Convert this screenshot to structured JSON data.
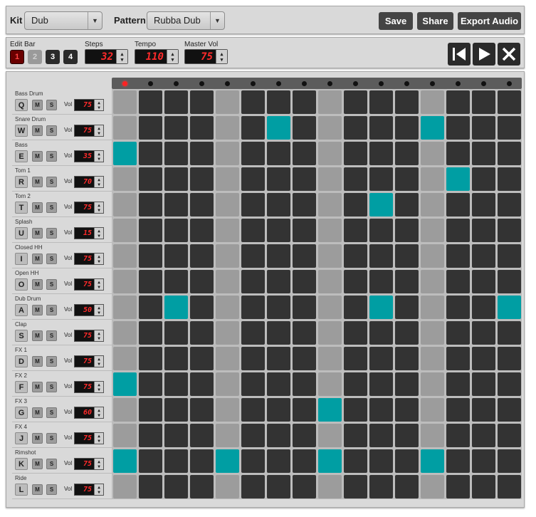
{
  "topbar": {
    "kit_label": "Kit",
    "kit_value": "Dub",
    "pattern_label": "Pattern",
    "pattern_value": "Rubba Dub",
    "save_label": "Save",
    "share_label": "Share",
    "export_label": "Export Audio"
  },
  "controls": {
    "edit_bar_label": "Edit Bar",
    "bars": [
      "1",
      "2",
      "3",
      "4"
    ],
    "active_bar": "1",
    "steps_label": "Steps",
    "steps_value": "32",
    "tempo_label": "Tempo",
    "tempo_value": "110",
    "master_vol_label": "Master Vol",
    "master_vol_value": "75"
  },
  "transport": {
    "rewind_icon": "skip-to-start-icon",
    "play_icon": "play-icon",
    "clear_icon": "close-icon"
  },
  "colors": {
    "active_step": "#009ea3",
    "step": "#333333",
    "beat_step": "#9c9c9c",
    "led_on": "#ff2222",
    "bar_active": "#6a0000"
  },
  "playhead_step": 0,
  "beat_columns": [
    0,
    4,
    8,
    12
  ],
  "track_buttons": {
    "mute": "M",
    "solo": "S",
    "vol_label": "Vol"
  },
  "tracks": [
    {
      "name": "Bass Drum",
      "key": "Q",
      "vol": "75",
      "steps": []
    },
    {
      "name": "Snare Drum",
      "key": "W",
      "vol": "75",
      "steps": [
        6,
        12
      ]
    },
    {
      "name": "Bass",
      "key": "E",
      "vol": "35",
      "steps": [
        0
      ]
    },
    {
      "name": "Tom 1",
      "key": "R",
      "vol": "70",
      "steps": [
        13
      ]
    },
    {
      "name": "Tom 2",
      "key": "T",
      "vol": "75",
      "steps": [
        10
      ]
    },
    {
      "name": "Splash",
      "key": "U",
      "vol": "15",
      "steps": []
    },
    {
      "name": "Closed HH",
      "key": "I",
      "vol": "75",
      "steps": []
    },
    {
      "name": "Open HH",
      "key": "O",
      "vol": "75",
      "steps": []
    },
    {
      "name": "Dub Drum",
      "key": "A",
      "vol": "50",
      "steps": [
        2,
        10,
        15
      ]
    },
    {
      "name": "Clap",
      "key": "S",
      "vol": "75",
      "steps": []
    },
    {
      "name": "FX 1",
      "key": "D",
      "vol": "75",
      "steps": []
    },
    {
      "name": "FX 2",
      "key": "F",
      "vol": "75",
      "steps": [
        0
      ]
    },
    {
      "name": "FX 3",
      "key": "G",
      "vol": "60",
      "steps": [
        8
      ]
    },
    {
      "name": "FX 4",
      "key": "J",
      "vol": "75",
      "steps": []
    },
    {
      "name": "Rimshot",
      "key": "K",
      "vol": "75",
      "steps": [
        0,
        4,
        8,
        12
      ]
    },
    {
      "name": "Ride",
      "key": "L",
      "vol": "75",
      "steps": []
    }
  ]
}
